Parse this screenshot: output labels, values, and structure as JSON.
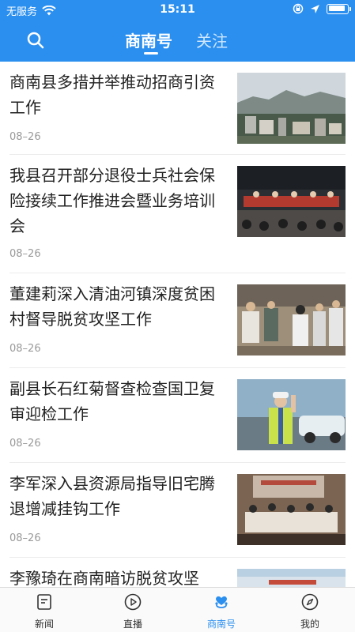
{
  "status_bar": {
    "carrier": "无服务",
    "time": "15:11"
  },
  "header": {
    "tabs": [
      {
        "label": "商南号",
        "active": true
      },
      {
        "label": "关注",
        "active": false
      }
    ]
  },
  "feed": {
    "items": [
      {
        "title": "商南县多措并举推动招商引资工作",
        "date": "08–26",
        "image": "city-landscape-photo"
      },
      {
        "title": "我县召开部分退役士兵社会保险接续工作推进会暨业务培训会",
        "date": "08–26",
        "image": "conference-meeting-photo"
      },
      {
        "title": "董建莉深入清油河镇深度贫困村督导脱贫攻坚工作",
        "date": "08–26",
        "image": "village-visit-photo"
      },
      {
        "title": "副县长石红菊督查检查国卫复审迎检工作",
        "date": "08–26",
        "image": "traffic-police-photo"
      },
      {
        "title": "李军深入县资源局指导旧宅腾退增减挂钩工作",
        "date": "08–26",
        "image": "office-meeting-photo"
      },
      {
        "title": "李豫琦在商南暗访脱贫攻坚",
        "date": "",
        "image": "partial-photo"
      }
    ]
  },
  "tabbar": {
    "items": [
      {
        "label": "新闻",
        "icon": "news-icon",
        "active": false
      },
      {
        "label": "直播",
        "icon": "play-icon",
        "active": false
      },
      {
        "label": "商南号",
        "icon": "heart-person-icon",
        "active": true
      },
      {
        "label": "我的",
        "icon": "compass-icon",
        "active": false
      }
    ]
  },
  "colors": {
    "brand_blue": "#2b8ff0",
    "date_gray": "#999999"
  }
}
